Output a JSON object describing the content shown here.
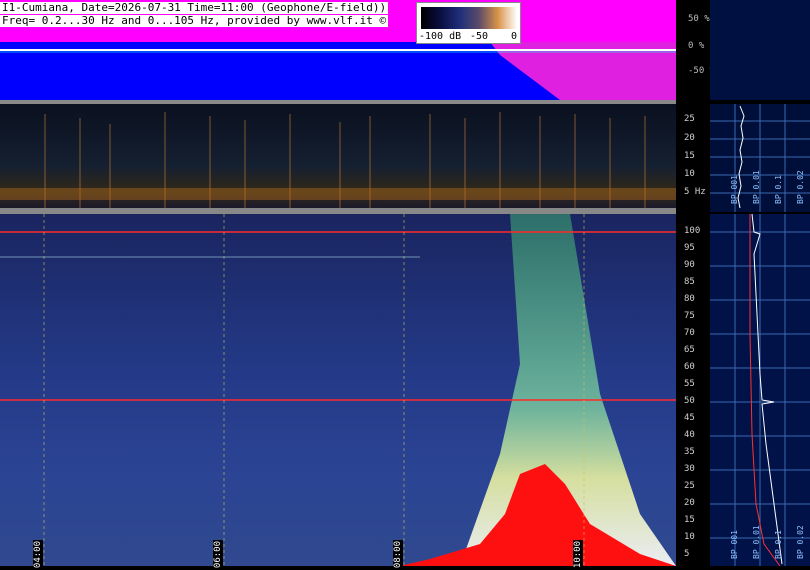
{
  "header": {
    "line1": "I1-Cumiana, Date=2026-07-31 Time=11:00 (Geophone/E-field))",
    "line2": "Freq= 0.2...30 Hz and 0...105 Hz, provided by www.vlf.it ©"
  },
  "color_scale": {
    "labels": [
      "-100 dB",
      "-50",
      "0"
    ]
  },
  "strip_axis": {
    "labels": [
      "50 %",
      "0 %",
      "-50 %"
    ]
  },
  "low_axis": {
    "labels": [
      "25",
      "20",
      "15",
      "10",
      "5 Hz"
    ]
  },
  "main_axis": {
    "labels": [
      "100",
      "95",
      "90",
      "85",
      "80",
      "75",
      "70",
      "65",
      "60",
      "55",
      "50",
      "45",
      "40",
      "35",
      "30",
      "25",
      "20",
      "15",
      "10",
      "5"
    ]
  },
  "time_markers": [
    "04:00",
    "06:00",
    "08:00",
    "10:00"
  ],
  "profile_labels": {
    "low": [
      "BP 001",
      "BP 0.01",
      "BP 0.1",
      "BP 0.02"
    ],
    "main": [
      "BP 001",
      "BP 0.01",
      "BP 0.1",
      "BP 0.02"
    ]
  },
  "colors": {
    "strip_fill": "#0000ff",
    "strip_overlay": "#ff00ff",
    "hum_line": "#ff0000",
    "trace": "#ffffff"
  }
}
